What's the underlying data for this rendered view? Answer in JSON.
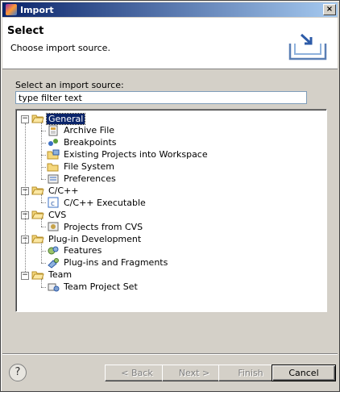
{
  "window": {
    "title": "Import",
    "close_glyph": "×"
  },
  "banner": {
    "title": "Select",
    "description": "Choose import source."
  },
  "source": {
    "label": "Select an import source:",
    "filter_value": "type filter text"
  },
  "tree": {
    "groups": [
      {
        "label": "General",
        "expander": "−",
        "items": [
          "Archive File",
          "Breakpoints",
          "Existing Projects into Workspace",
          "File System",
          "Preferences"
        ]
      },
      {
        "label": "C/C++",
        "expander": "−",
        "items": [
          "C/C++ Executable"
        ]
      },
      {
        "label": "CVS",
        "expander": "−",
        "items": [
          "Projects from CVS"
        ]
      },
      {
        "label": "Plug-in Development",
        "expander": "−",
        "items": [
          "Features",
          "Plug-ins and Fragments"
        ]
      },
      {
        "label": "Team",
        "expander": "−",
        "items": [
          "Team Project Set"
        ]
      }
    ]
  },
  "buttons": {
    "help": "?",
    "back": "< Back",
    "next": "Next >",
    "finish": "Finish",
    "cancel": "Cancel"
  },
  "colors": {
    "selection": "#0a246a",
    "dialog_bg": "#d4d0c8",
    "titlebar_start": "#0a246a",
    "titlebar_end": "#a6caf0"
  }
}
